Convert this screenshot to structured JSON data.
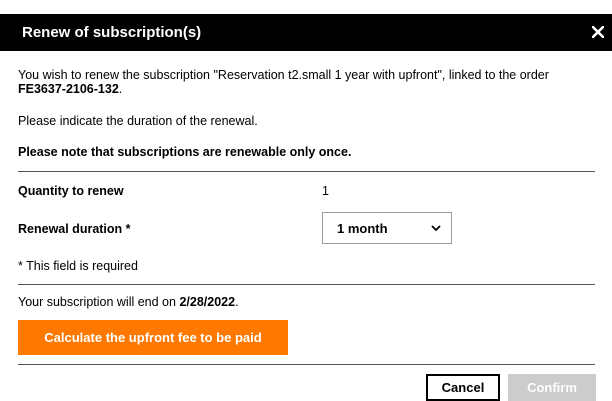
{
  "dialog": {
    "title": "Renew of subscription(s)",
    "close_icon": "close-icon",
    "close_glyph": "✕"
  },
  "intro": {
    "text_before": "You wish to renew the subscription \"Reservation t2.small 1 year with upfront\", linked to the order ",
    "order_number": "FE3637-2106-132",
    "text_after": "."
  },
  "instruction": "Please indicate the duration of the renewal.",
  "note": "Please note that subscriptions are renewable only once.",
  "quantity": {
    "label": "Quantity to renew",
    "value": "1"
  },
  "duration": {
    "label": "Renewal duration *",
    "selected": "1 month",
    "chevron_icon": "chevron-down-icon"
  },
  "required_note": "* This field is required",
  "end_date": {
    "prefix": "Your subscription will end on ",
    "date": "2/28/2022",
    "suffix": "."
  },
  "buttons": {
    "calculate": "Calculate the upfront fee to be paid",
    "cancel": "Cancel",
    "confirm": "Confirm"
  },
  "colors": {
    "header_bg": "#000000",
    "accent": "#ff7900",
    "disabled": "#cccccc"
  }
}
